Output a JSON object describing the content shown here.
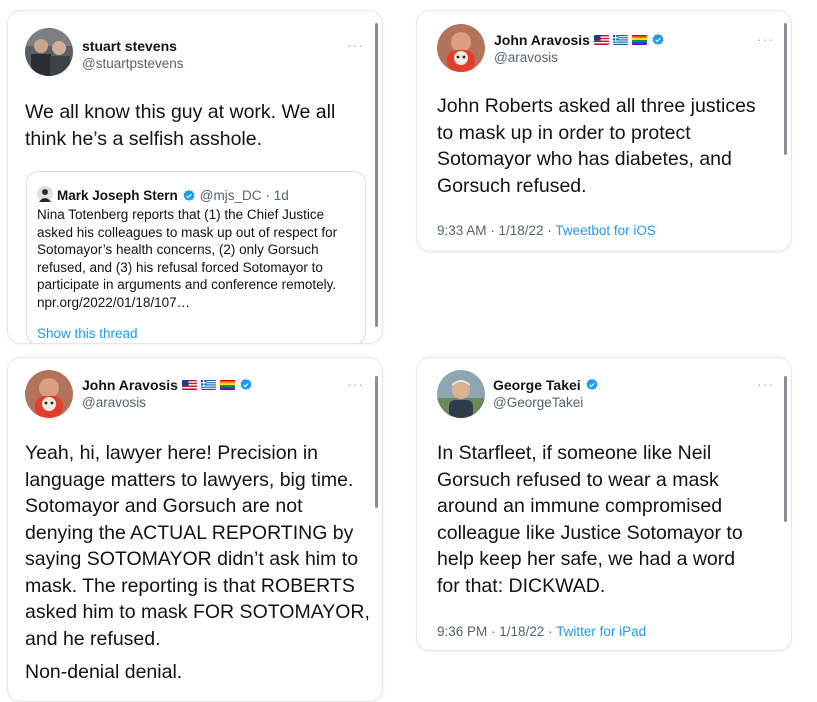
{
  "tweets": [
    {
      "author": "stuart stevens",
      "handle": "@stuartpstevens",
      "text": "We all know this guy at work. We all think he’s a selfish asshole.",
      "more": "···",
      "quote": {
        "author": "Mark Joseph Stern",
        "handle": "@mjs_DC",
        "time": "· 1d",
        "text": "Nina Totenberg reports that (1) the Chief Justice asked his colleagues to mask up out of respect for Sotomayor’s health concerns, (2) only Gorsuch refused, and (3) his refusal forced Sotomayor to participate in arguments and conference remotely. npr.org/2022/01/18/107…",
        "show_thread": "Show this thread"
      }
    },
    {
      "author": "John Aravosis",
      "handle": "@aravosis",
      "text": "John Roberts asked all three justices to mask up in order to protect Sotomayor who has diabetes, and Gorsuch refused.",
      "time": "9:33 AM · 1/18/22 · ",
      "source": "Tweetbot for iOS",
      "more": "···"
    },
    {
      "author": "John Aravosis",
      "handle": "@aravosis",
      "text": "Yeah, hi, lawyer here! Precision in language matters to lawyers, big time. Sotomayor and Gorsuch are not denying the ACTUAL REPORTING by saying SOTOMAYOR didn’t ask him to mask. The reporting is that ROBERTS asked him to mask FOR SOTOMAYOR, and he refused.",
      "text2": "Non-denial denial.",
      "more": "···"
    },
    {
      "author": "George Takei",
      "handle": "@GeorgeTakei",
      "text": "In Starfleet, if someone like Neil Gorsuch refused to wear a mask around an immune compromised colleague like Justice Sotomayor to help keep her safe, we had a word for that: DICKWAD.",
      "time": "9:36 PM · 1/18/22 · ",
      "source": "Twitter for iPad",
      "more": "···"
    }
  ],
  "colors": {
    "link": "#1d9bf0",
    "verified": "#1d9bf0",
    "muted": "#536471",
    "text": "#0f1419"
  },
  "icons": [
    "verified-badge-icon",
    "more-options-icon",
    "us-flag-icon",
    "greek-flag-icon",
    "rainbow-flag-icon"
  ]
}
